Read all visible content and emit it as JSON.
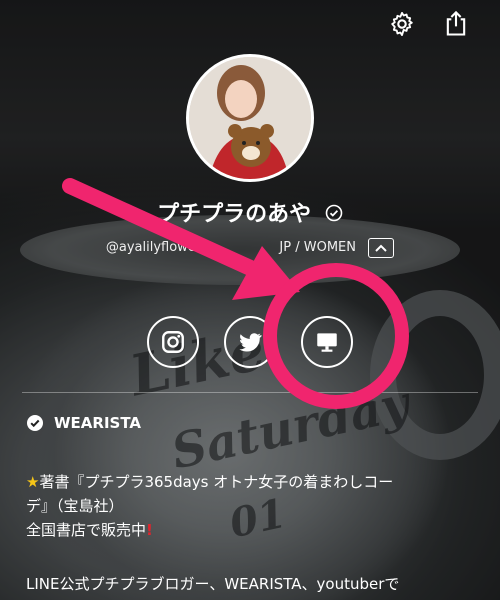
{
  "profile": {
    "name": "プチプラのあや",
    "handle": "@ayalilyflower",
    "handle_suffix": "JP / WOMEN"
  },
  "icons": {
    "settings": "gear-icon",
    "share": "share-icon",
    "verified": "verified-badge-icon",
    "collapse": "chevron-up-icon",
    "instagram": "instagram-icon",
    "twitter": "twitter-icon",
    "website": "monitor-icon"
  },
  "section": {
    "title": "WEARISTA"
  },
  "bio": {
    "line1": "著書『プチプラ365days オトナ女子の着まわしコー",
    "line2": "デ』（宝島社）",
    "line3": "全国書店で販売中",
    "line4": "LINE公式プチプラブロガー、WEARISTA、youtuberで"
  },
  "colors": {
    "annotation": "#f0256e",
    "text": "#ffffff",
    "star": "#f5c518",
    "exclamation": "#e0242d"
  }
}
